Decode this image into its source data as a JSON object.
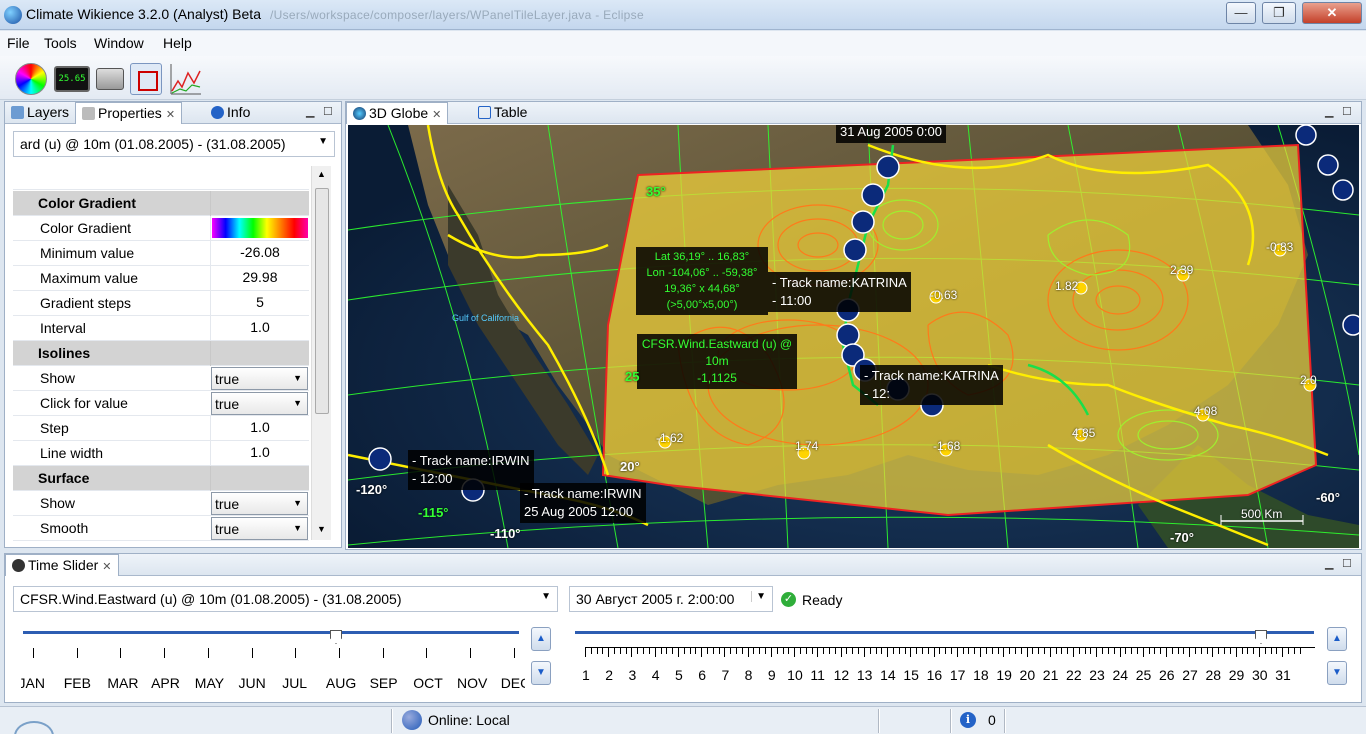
{
  "window": {
    "title": "Climate Wikience 3.2.0 (Analyst) Beta",
    "path": "/Users/workspace/composer/layers/WPanelTileLayer.java - Eclipse",
    "controls": [
      "—",
      "❐",
      "✕"
    ]
  },
  "menu": [
    "File",
    "Tools",
    "Window",
    "Help"
  ],
  "toolbar": {
    "lcd_value": "25.65"
  },
  "left_panel": {
    "tabs": [
      "Layers",
      "Properties",
      "Info"
    ],
    "layer_select": "ard (u) @ 10m  (01.08.2005)  -  (31.08.2005)",
    "rows": [
      {
        "key": "Color Gradient",
        "section": true
      },
      {
        "key": "Color Gradient",
        "gradient": true
      },
      {
        "key": "Minimum value",
        "value": "-26.08"
      },
      {
        "key": "Maximum value",
        "value": "29.98"
      },
      {
        "key": "Gradient steps",
        "value": "5"
      },
      {
        "key": "Interval",
        "value": "1.0"
      },
      {
        "key": "Isolines",
        "section": true
      },
      {
        "key": "Show",
        "select": "true"
      },
      {
        "key": "Click for value",
        "select": "true"
      },
      {
        "key": "Step",
        "value": "1.0"
      },
      {
        "key": "Line width",
        "value": "1.0"
      },
      {
        "key": "Surface",
        "section": true
      },
      {
        "key": "Show",
        "select": "true"
      },
      {
        "key": "Smooth",
        "select": "true"
      }
    ]
  },
  "globe_panel": {
    "tabs": [
      "3D Globe",
      "Table"
    ],
    "labels": {
      "date_top": "31 Aug 2005 0:00",
      "lat_tip": [
        "Lat  36,19° .. 16,83°",
        "Lon -104,06° .. -59,38°",
        "19,36° x 44,68°",
        "(>5,00°x5,00°)"
      ],
      "value_tip": [
        "CFSR.Wind.Eastward (u) @",
        "10m",
        "-1,1125"
      ],
      "katrina1": [
        "- Track name:KATRINA",
        "- 11:00"
      ],
      "katrina2": [
        "- Track name:KATRINA",
        "- 12:"
      ],
      "irwin1": [
        "- Track name:IRWIN",
        "- 12:00"
      ],
      "irwin2": [
        "- Track name:IRWIN",
        "25 Aug 2005 12:00"
      ],
      "gulf": "Gulf of California",
      "scale": "500 Km",
      "lat35": "35°",
      "lat25": "25",
      "lat20": "20°",
      "lon120": "-120°",
      "lon115": "-115°",
      "lon110": "-110°",
      "lon70": "-70°",
      "lon60": "-60°",
      "vals": [
        "-0.83",
        "2.39",
        "1.82",
        "-0.63",
        "-1.62",
        "1.74",
        "-1.68",
        "4.08",
        "4.85",
        "2.0"
      ]
    }
  },
  "time_slider": {
    "tab": "Time Slider",
    "layer_select": "CFSR.Wind.Eastward (u) @ 10m  (01.08.2005)  -  (31.08.2005)",
    "datetime": "30 Август 2005 г. 2:00:00",
    "status": "Ready",
    "months": [
      "JAN",
      "FEB",
      "MAR",
      "APR",
      "MAY",
      "JUN",
      "JUL",
      "AUG",
      "SEP",
      "OCT",
      "NOV",
      "DEC"
    ],
    "selected_month": "AUG",
    "days": [
      "1",
      "2",
      "3",
      "4",
      "5",
      "6",
      "7",
      "8",
      "9",
      "10",
      "11",
      "12",
      "13",
      "14",
      "15",
      "16",
      "17",
      "18",
      "19",
      "20",
      "21",
      "22",
      "23",
      "24",
      "25",
      "26",
      "27",
      "28",
      "29",
      "30",
      "31"
    ],
    "selected_day": "30"
  },
  "status_bar": {
    "online": "Online: Local",
    "count": "0"
  }
}
